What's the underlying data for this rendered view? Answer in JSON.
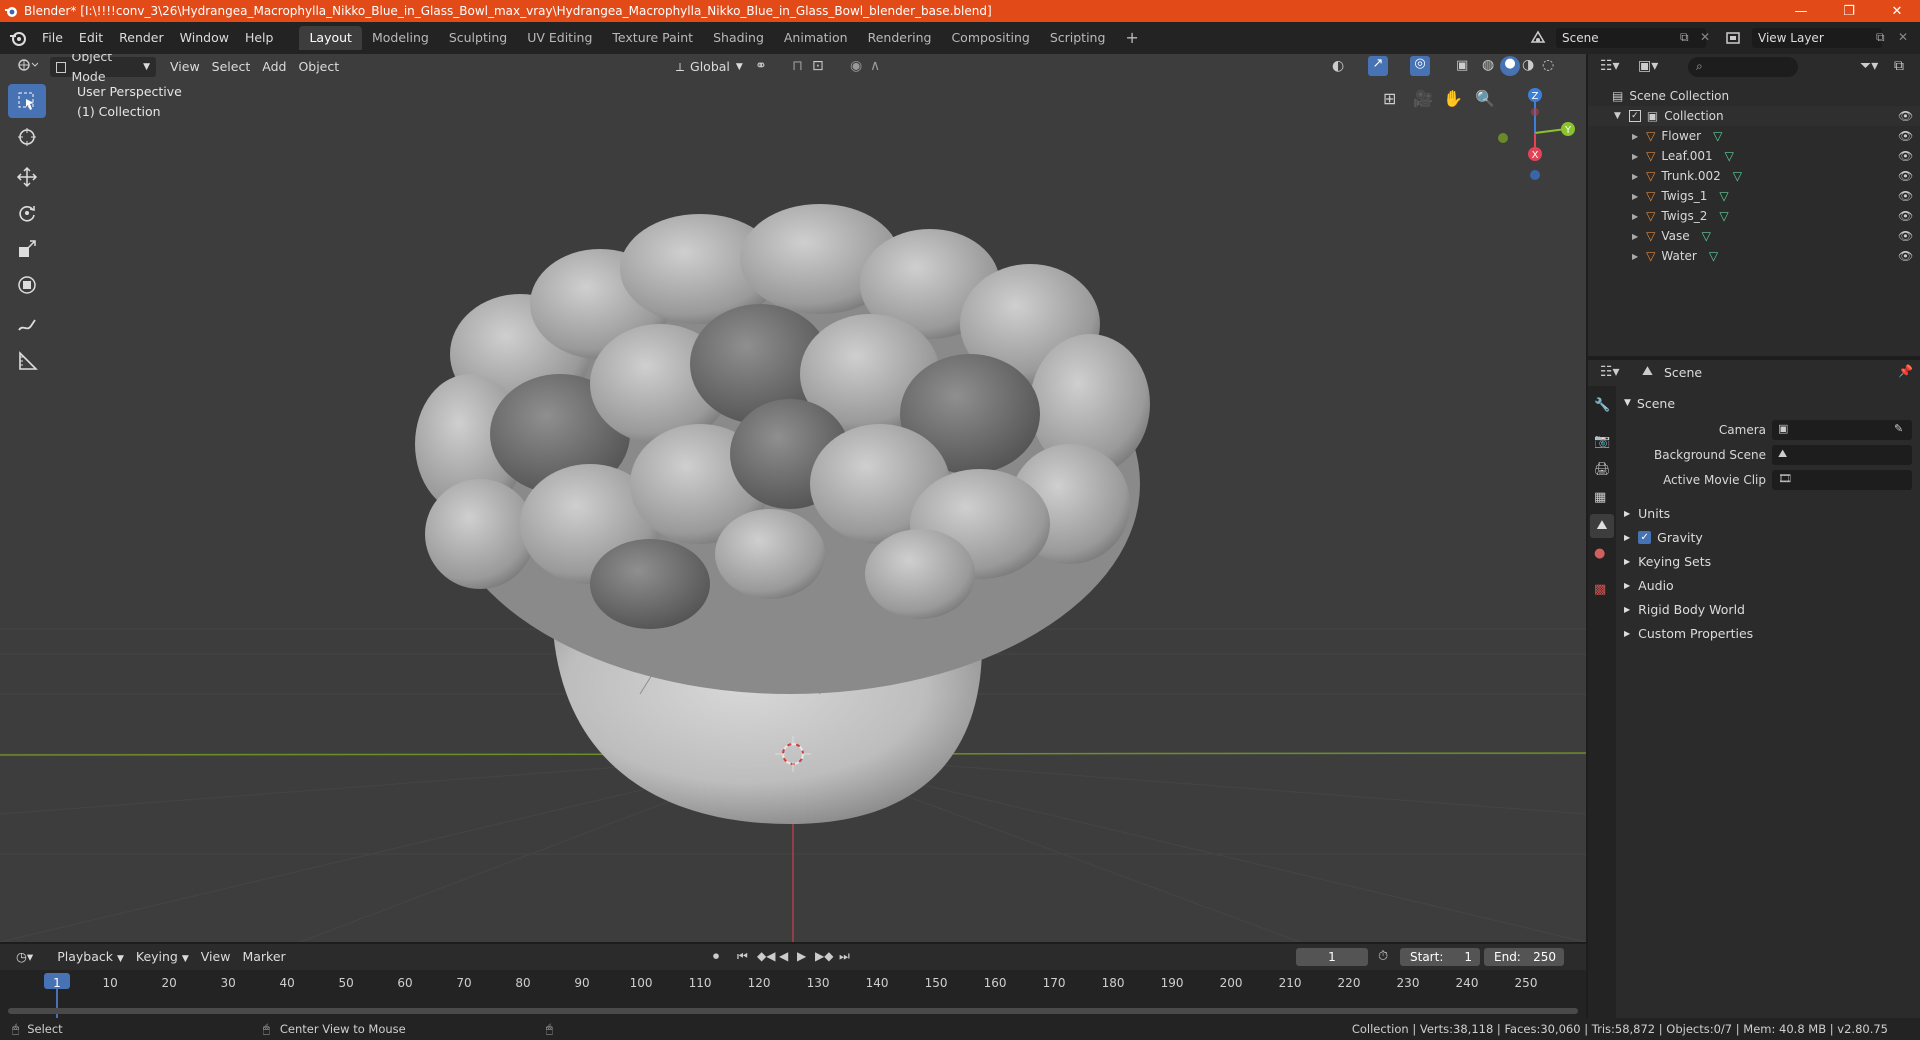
{
  "titlebar": {
    "title": "Blender* [I:\\!!!!conv_3\\26\\Hydrangea_Macrophylla_Nikko_Blue_in_Glass_Bowl_max_vray\\Hydrangea_Macrophylla_Nikko_Blue_in_Glass_Bowl_blender_base.blend]",
    "minimize": "—",
    "restore": "❐",
    "close": "✕"
  },
  "menu": [
    "File",
    "Edit",
    "Render",
    "Window",
    "Help"
  ],
  "workspaces": [
    "Layout",
    "Modeling",
    "Sculpting",
    "UV Editing",
    "Texture Paint",
    "Shading",
    "Animation",
    "Rendering",
    "Compositing",
    "Scripting"
  ],
  "workspace_add": "+",
  "scene_field": "Scene",
  "view_layer_field": "View Layer",
  "viewport": {
    "mode": "Object Mode",
    "menus": [
      "View",
      "Select",
      "Add",
      "Object"
    ],
    "orientation": "Global",
    "perspective_label": "User Perspective",
    "collection_label": "(1) Collection",
    "gizmo": {
      "z": "Z",
      "y": "Y",
      "x": "X"
    }
  },
  "outliner": {
    "root": "Scene Collection",
    "collection": "Collection",
    "items": [
      "Flower",
      "Leaf.001",
      "Trunk.002",
      "Twigs_1",
      "Twigs_2",
      "Vase",
      "Water"
    ]
  },
  "properties": {
    "header": "Scene",
    "panel": "Scene",
    "fields": [
      {
        "label": "Camera"
      },
      {
        "label": "Background Scene"
      },
      {
        "label": "Active Movie Clip"
      }
    ],
    "sections": [
      "Units",
      "Gravity",
      "Keying Sets",
      "Audio",
      "Rigid Body World",
      "Custom Properties"
    ]
  },
  "timeline": {
    "menus": [
      "Playback",
      "Keying",
      "View",
      "Marker"
    ],
    "current_frame": "1",
    "start_label": "Start:",
    "start": "1",
    "end_label": "End:",
    "end": "250",
    "ticks": [
      "1",
      "10",
      "20",
      "30",
      "40",
      "50",
      "60",
      "70",
      "80",
      "90",
      "100",
      "110",
      "120",
      "130",
      "140",
      "150",
      "160",
      "170",
      "180",
      "190",
      "200",
      "210",
      "220",
      "230",
      "240",
      "250"
    ]
  },
  "statusbar": {
    "left_action": "Select",
    "middle_action": "Center View to Mouse",
    "stats": "Collection | Verts:38,118 | Faces:30,060 | Tris:58,872 | Objects:0/7 | Mem: 40.8 MB | v2.80.75"
  },
  "colors": {
    "title_bar": "#e24b18",
    "accent": "#4772b3",
    "object_icon": "#e0883a",
    "mesh_icon": "#5fcf9c",
    "axis_x": "#e24356",
    "axis_y": "#8bc32d",
    "axis_z": "#3c7fd8"
  }
}
